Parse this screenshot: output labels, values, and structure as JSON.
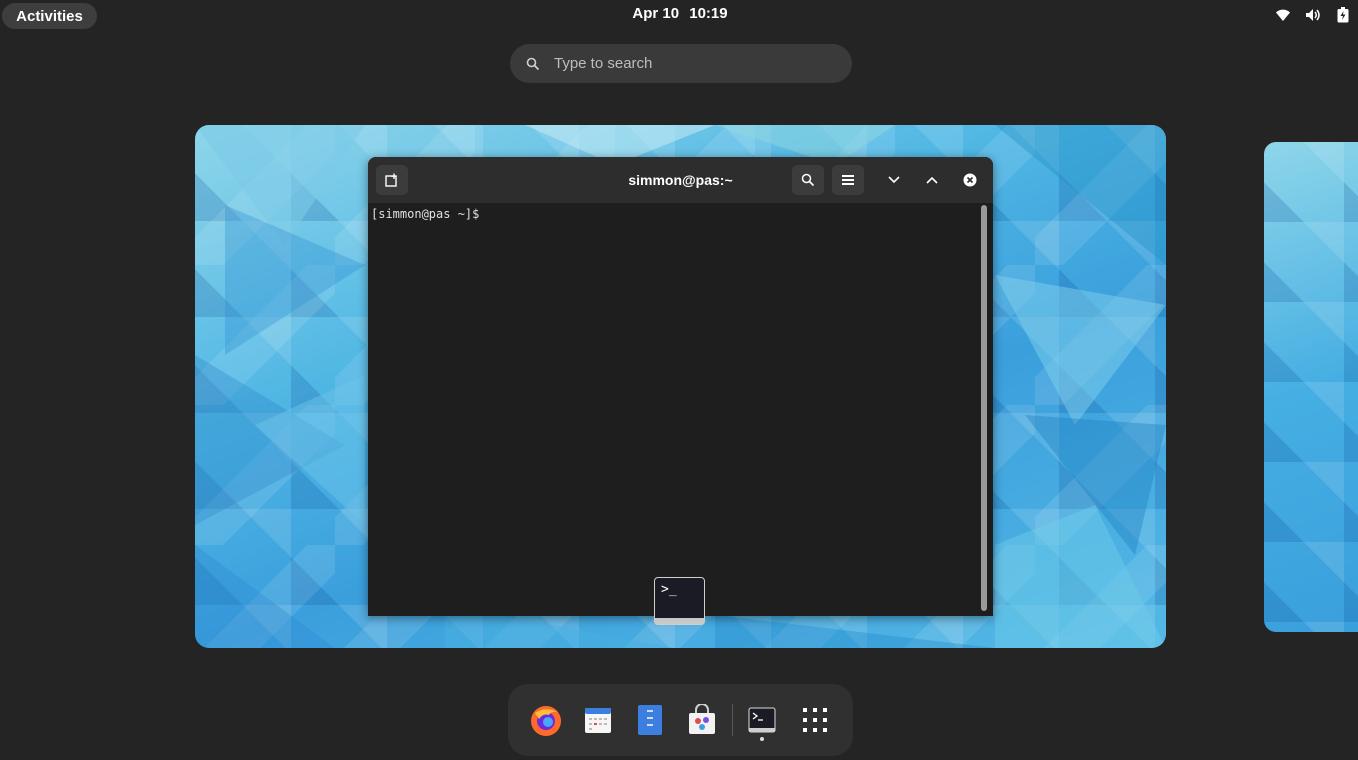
{
  "topbar": {
    "activities_label": "Activities",
    "date": "Apr 10",
    "time": "10:19",
    "system_icons": [
      "wifi-icon",
      "volume-icon",
      "battery-icon"
    ]
  },
  "search": {
    "placeholder": "Type to search"
  },
  "terminal": {
    "title": "simmon@pas:~",
    "prompt": "[simmon@pas ~]$",
    "buttons": [
      "new-tab-icon",
      "search-icon",
      "menu-icon",
      "minimize-icon",
      "maximize-icon",
      "close-icon"
    ]
  },
  "dock": {
    "apps": [
      "Firefox",
      "Calendar",
      "Text Editor",
      "Software",
      "Terminal",
      "Show Apps"
    ]
  },
  "colors": {
    "background": "#242424",
    "panel": "#303030",
    "terminal_bg": "#1e1e1e",
    "titlebar": "#2d2d2d",
    "wallpaper_blue": "#3a9fdc"
  }
}
